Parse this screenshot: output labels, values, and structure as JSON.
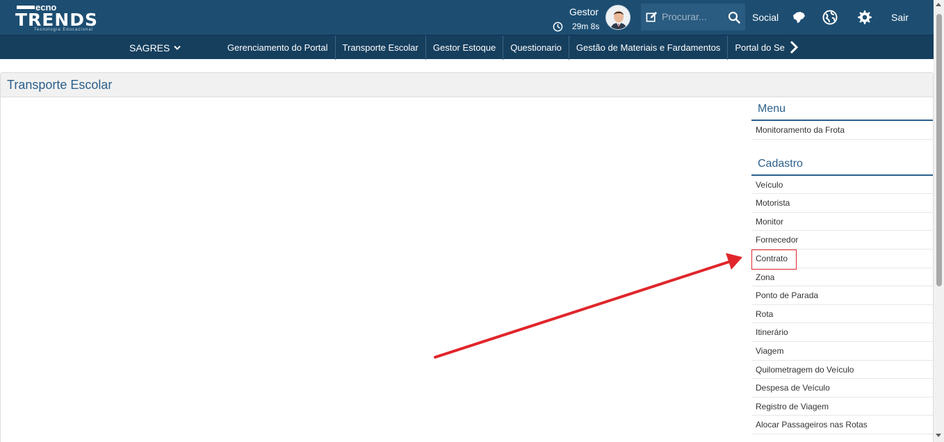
{
  "header": {
    "logo_text": "TRENDS",
    "logo_super": "ecno",
    "logo_tagline": "Tecnologia Educacional",
    "user_name": "Gestor",
    "session_timer": "29m 8s",
    "search": {
      "placeholder": "Procurar..."
    },
    "social_label": "Social",
    "logout_label": "Sair",
    "icons": [
      "clock-icon",
      "edit-icon",
      "search-icon",
      "map-icon",
      "globe-icon",
      "gear-icon"
    ]
  },
  "navbar": {
    "module_label": "SAGRES",
    "items": [
      {
        "label": "Gerenciamento do Portal"
      },
      {
        "label": "Transporte Escolar"
      },
      {
        "label": "Gestor Estoque"
      },
      {
        "label": "Questionario"
      },
      {
        "label": "Gestão de Materiais e Fardamentos"
      },
      {
        "label": "Portal do Se"
      }
    ]
  },
  "panel": {
    "title": "Transporte Escolar"
  },
  "sidebar": {
    "menu_title": "Menu",
    "menu_items": [
      {
        "label": "Monitoramento da Frota"
      }
    ],
    "cadastro_title": "Cadastro",
    "cadastro_items": [
      {
        "label": "Veículo"
      },
      {
        "label": "Motorista"
      },
      {
        "label": "Monitor"
      },
      {
        "label": "Fornecedor"
      },
      {
        "label": "Contrato"
      },
      {
        "label": "Zona"
      },
      {
        "label": "Ponto de Parada"
      },
      {
        "label": "Rota"
      },
      {
        "label": "Itinerário"
      },
      {
        "label": "Viagem"
      },
      {
        "label": "Quilometragem do Veículo"
      },
      {
        "label": "Despesa de Veículo"
      },
      {
        "label": "Registro de Viagem"
      },
      {
        "label": "Alocar Passageiros nas Rotas"
      }
    ]
  },
  "colors": {
    "header_bg": "#1d4e72",
    "navbar_bg": "#163f5e",
    "accent": "#2b5f8b",
    "annotation": "#e0262b"
  }
}
